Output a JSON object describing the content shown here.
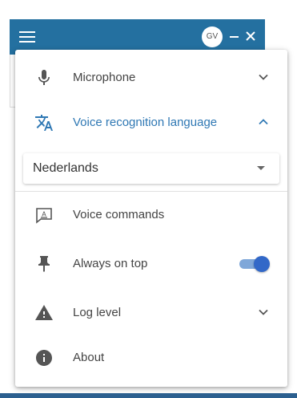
{
  "app": {
    "avatar_initials": "GV",
    "bar_color": "#2470a0"
  },
  "menu": {
    "microphone": {
      "label": "Microphone",
      "icon": "microphone-icon",
      "expanded": false
    },
    "language": {
      "label": "Voice recognition language",
      "icon": "translate-icon",
      "expanded": true,
      "selected": "Nederlands",
      "accent": "#2f78b4"
    },
    "voice_commands": {
      "label": "Voice commands",
      "icon": "keyboard-box-icon"
    },
    "always_on_top": {
      "label": "Always on top",
      "icon": "pin-icon",
      "enabled": true,
      "toggle_color": "#3268c8"
    },
    "log_level": {
      "label": "Log level",
      "icon": "warning-icon",
      "expanded": false
    },
    "about": {
      "label": "About",
      "icon": "info-icon"
    }
  }
}
